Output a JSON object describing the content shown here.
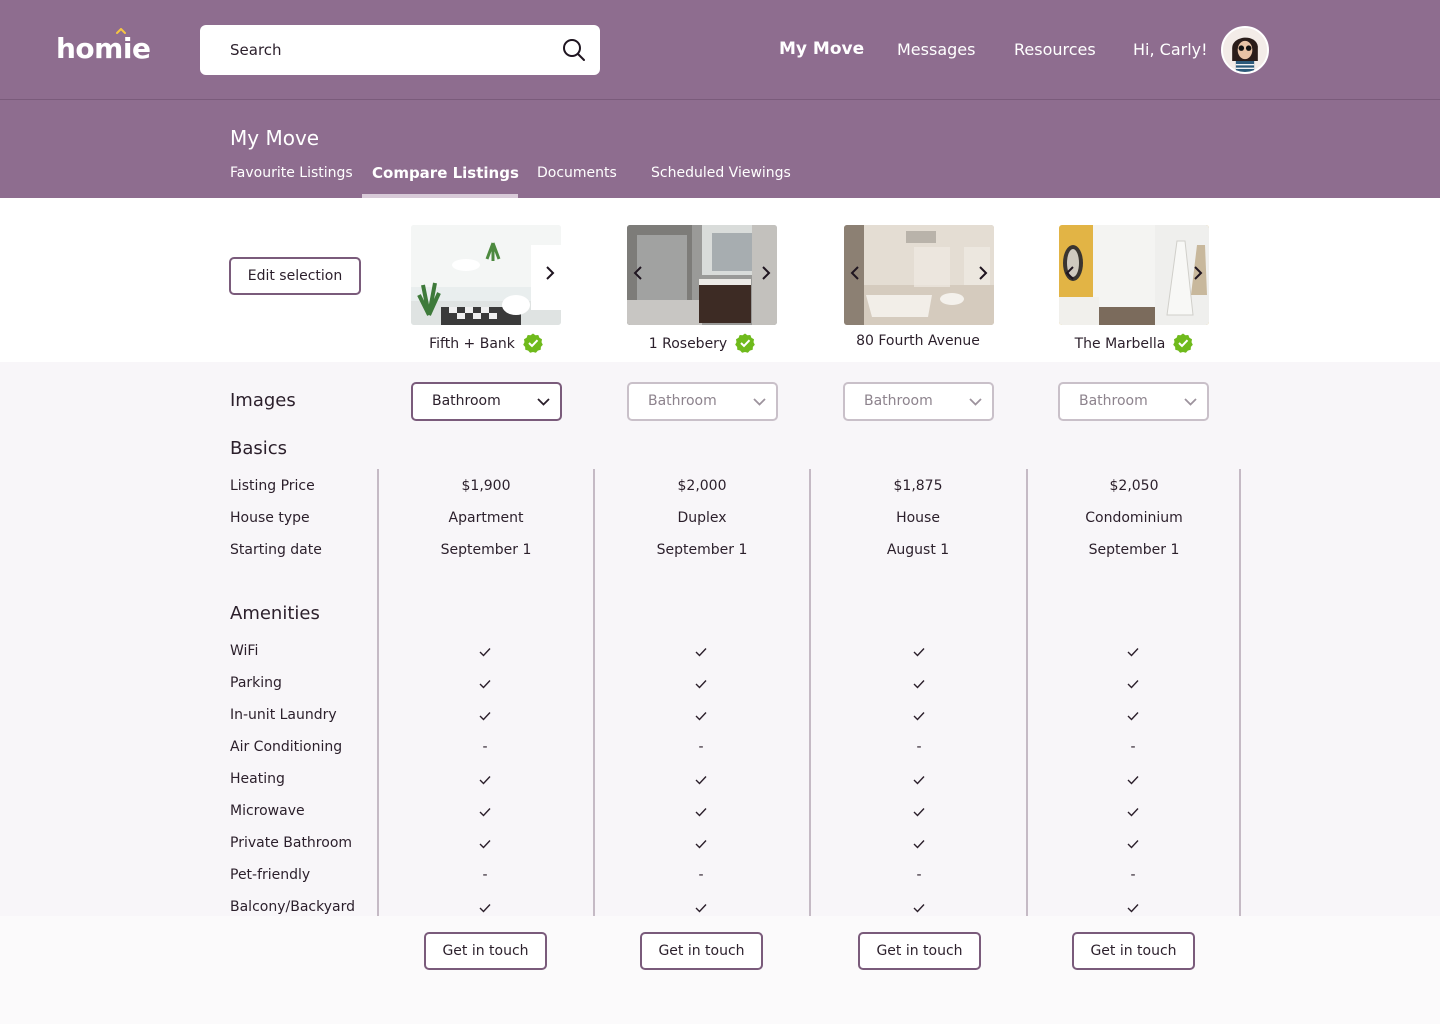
{
  "header": {
    "logo": "homie",
    "search_placeholder": "Search",
    "nav": {
      "my_move": "My Move",
      "messages": "Messages",
      "resources": "Resources",
      "greeting": "Hi, Carly!"
    }
  },
  "subheader": {
    "title": "My Move",
    "tabs": {
      "favourites": "Favourite Listings",
      "compare": "Compare Listings",
      "documents": "Documents",
      "viewings": "Scheduled Viewings"
    },
    "active_tab": "Compare Listings"
  },
  "actions": {
    "edit_selection": "Edit selection",
    "contact": "Get in touch"
  },
  "listings": [
    {
      "name": "Fifth + Bank",
      "verified": true,
      "image_filter": "Bathroom"
    },
    {
      "name": "1 Rosebery",
      "verified": true,
      "image_filter": "Bathroom"
    },
    {
      "name": "80 Fourth Avenue",
      "verified": false,
      "image_filter": "Bathroom"
    },
    {
      "name": "The Marbella",
      "verified": true,
      "image_filter": "Bathroom"
    }
  ],
  "sections": {
    "images": "Images",
    "basics": "Basics",
    "amenities": "Amenities"
  },
  "basics_rows": {
    "price": "Listing Price",
    "house_type": "House type",
    "start": "Starting date"
  },
  "basics_values": {
    "price": [
      "$1,900",
      "$2,000",
      "$1,875",
      "$2,050"
    ],
    "house_type": [
      "Apartment",
      "Duplex",
      "House",
      "Condominium"
    ],
    "start": [
      "September 1",
      "September 1",
      "August 1",
      "September 1"
    ]
  },
  "amenities": [
    {
      "label": "WiFi",
      "values": [
        true,
        true,
        true,
        true
      ]
    },
    {
      "label": "Parking",
      "values": [
        true,
        true,
        true,
        true
      ]
    },
    {
      "label": "In-unit Laundry",
      "values": [
        true,
        true,
        true,
        true
      ]
    },
    {
      "label": "Air Conditioning",
      "values": [
        false,
        false,
        false,
        false
      ]
    },
    {
      "label": "Heating",
      "values": [
        true,
        true,
        true,
        true
      ]
    },
    {
      "label": "Microwave",
      "values": [
        true,
        true,
        true,
        true
      ]
    },
    {
      "label": "Private Bathroom",
      "values": [
        true,
        true,
        true,
        true
      ]
    },
    {
      "label": "Pet-friendly",
      "values": [
        false,
        false,
        false,
        false
      ]
    },
    {
      "label": "Balcony/Backyard",
      "values": [
        true,
        true,
        true,
        true
      ]
    }
  ],
  "missing_symbol": "-",
  "colors": {
    "brand_purple": "#8e6d8f",
    "button_border": "#7a5b7b",
    "verified_green": "#6fba1c",
    "logo_accent": "#f5c542"
  },
  "icons": {
    "search": "search-icon",
    "verified": "verified-badge-icon",
    "dropdown": "chevron-down-icon",
    "carousel_next": "chevron-right-icon",
    "carousel_prev": "chevron-left-icon",
    "available": "check-icon"
  }
}
